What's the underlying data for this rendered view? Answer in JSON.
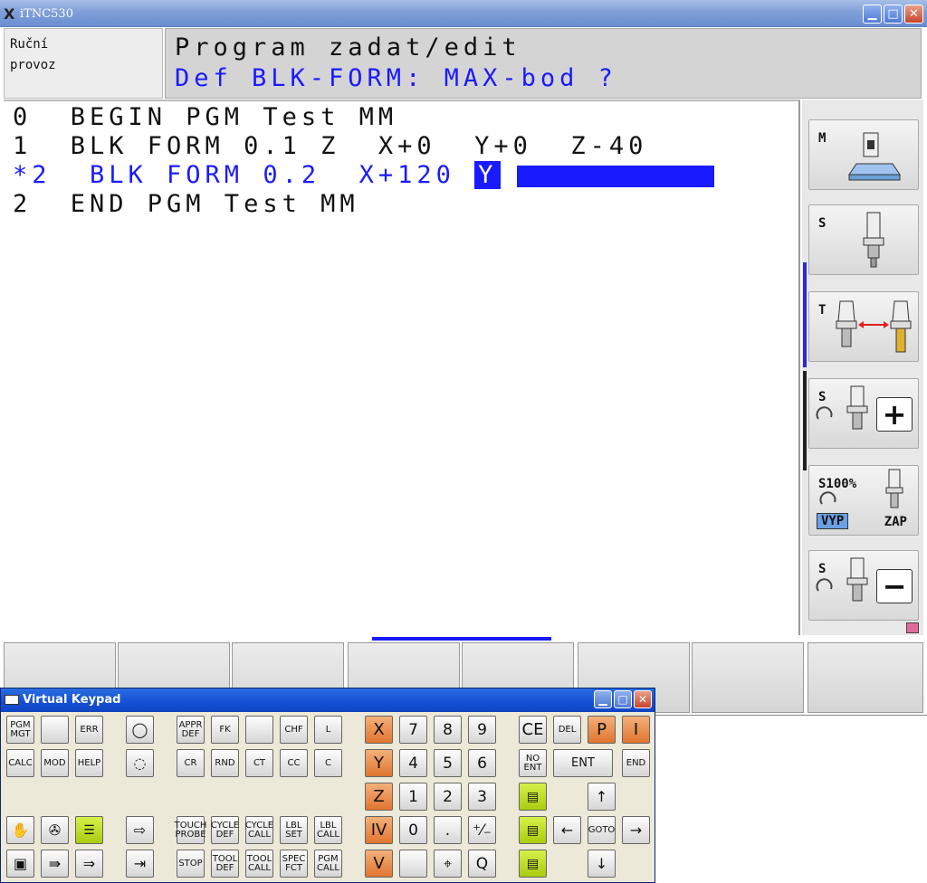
{
  "window": {
    "title": "iTNC530",
    "logo": "X"
  },
  "mode": {
    "line1": "Ruční",
    "line2": "provoz"
  },
  "program": {
    "title": "Program zadat/edit",
    "prompt": "Def BLK-FORM: MAX-bod ?",
    "lines": [
      {
        "text": "0  BEGIN PGM Test MM"
      },
      {
        "text": "1  BLK FORM 0.1 Z  X+0  Y+0  Z-40"
      },
      {
        "text": "*2  BLK FORM 0.2  X+120 ",
        "cursor": "Y"
      },
      {
        "text": "2  END PGM Test MM"
      }
    ]
  },
  "softkeys": {
    "m": "M",
    "s1": "S",
    "t": "T",
    "s_plus": "S",
    "plus": "+",
    "s100": "S100%",
    "vyp": "VYP",
    "zap": "ZAP",
    "s_minus": "S",
    "minus": "−"
  },
  "keypad": {
    "title": "Virtual Keypad",
    "keys": {
      "pgm_mgt": "PGM MGT",
      "err": "ERR",
      "calc": "CALC",
      "mod": "MOD",
      "help": "HELP",
      "appr_def": "APPR DEF",
      "fk": "FK",
      "chf": "CHF",
      "l": "L",
      "cr": "CR",
      "rnd": "RND",
      "ct": "CT",
      "cc": "CC",
      "c": "C",
      "touch_probe": "TOUCH PROBE",
      "cycle_def": "CYCLE DEF",
      "cycle_call": "CYCLE CALL",
      "lbl_set": "LBL SET",
      "lbl_call": "LBL CALL",
      "stop": "STOP",
      "tool_def": "TOOL DEF",
      "tool_call": "TOOL CALL",
      "spec_fct": "SPEC FCT",
      "pgm_call": "PGM CALL",
      "x": "X",
      "y": "Y",
      "z": "Z",
      "iv": "IV",
      "v": "V",
      "n7": "7",
      "n8": "8",
      "n9": "9",
      "n4": "4",
      "n5": "5",
      "n6": "6",
      "n1": "1",
      "n2": "2",
      "n3": "3",
      "n0": "0",
      "dot": ".",
      "pm": "⁺⁄₋",
      "q": "Q",
      "ce": "CE",
      "del": "DEL",
      "p": "P",
      "i": "I",
      "no_ent": "NO ENT",
      "ent": "ENT",
      "end": "END",
      "goto": "GOTO"
    }
  }
}
